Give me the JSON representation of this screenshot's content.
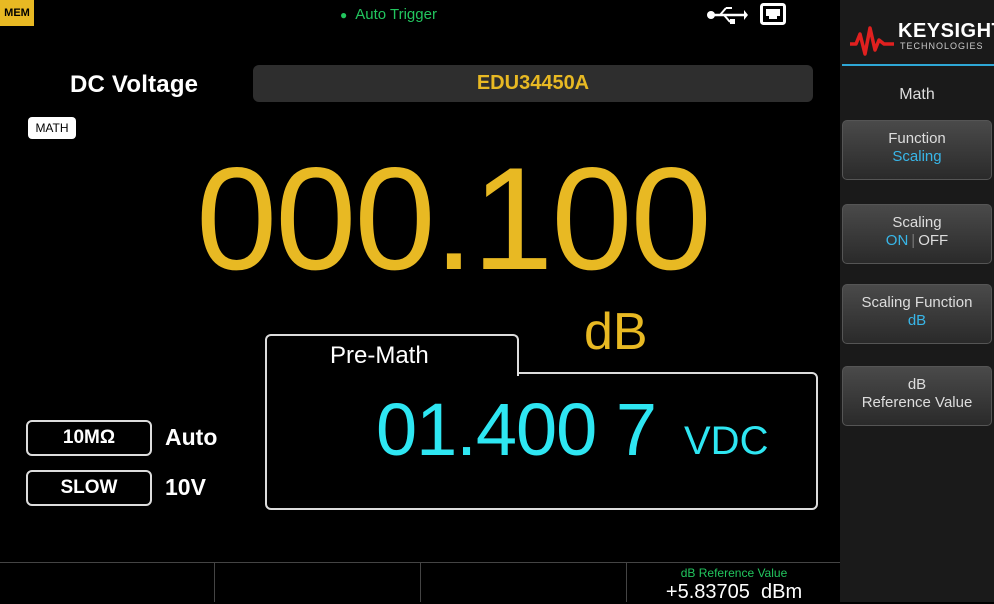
{
  "status": {
    "mem_badge": "MEM",
    "trigger": "Auto Trigger",
    "usb_icon": "usb-icon",
    "lan_icon": "lan-icon"
  },
  "header": {
    "function": "DC Voltage",
    "model": "EDU34450A",
    "math_badge": "MATH"
  },
  "reading": {
    "value": "000.100",
    "unit": "dB"
  },
  "pre_math": {
    "label": "Pre-Math",
    "value": "01.400 7",
    "unit": "VDC"
  },
  "settings": {
    "impedance": "10MΩ",
    "range_mode": "Auto",
    "speed": "SLOW",
    "range": "10V"
  },
  "bottom_bar": {
    "db_ref_label": "dB Reference Value",
    "db_ref_value": "+5.83705  dBm"
  },
  "panel": {
    "brand": "KEYSIGHT",
    "brand_sub": "TECHNOLOGIES",
    "menu_title": "Math",
    "softkeys": [
      {
        "label": "Function",
        "value": "Scaling"
      },
      {
        "label": "Scaling",
        "on": "ON",
        "off": "OFF"
      },
      {
        "label": "Scaling Function",
        "value": "dB"
      },
      {
        "label": "dB",
        "label2": "Reference Value"
      }
    ]
  },
  "colors": {
    "accent_yellow": "#e8b923",
    "accent_cyan": "#2ee6f2",
    "trigger_green": "#22c55e",
    "softkey_value_blue": "#38b6e8"
  }
}
